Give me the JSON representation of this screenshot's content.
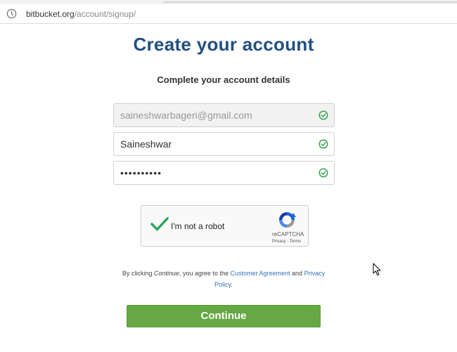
{
  "browser": {
    "url_domain": "bitbucket.org",
    "url_path": "/account/signup/"
  },
  "page": {
    "title": "Create your account",
    "subtitle": "Complete your account details"
  },
  "form": {
    "email_value": "saineshwarbageri@gmail.com",
    "name_value": "Saineshwar",
    "password_masked": "••••••••••"
  },
  "captcha": {
    "label": "I'm not a robot",
    "brand": "reCAPTCHA",
    "links": "Privacy - Terms"
  },
  "legal": {
    "prefix": "By clicking ",
    "continue_word": "Continue",
    "middle": ", you agree to the ",
    "customer_agreement": "Customer Agreement",
    "and": " and ",
    "privacy_policy": "Privacy Policy",
    "suffix": "."
  },
  "actions": {
    "continue_label": "Continue"
  },
  "icons": {
    "site_info": "info-circle-icon",
    "valid": "check-circle-icon",
    "captcha_check": "checkmark-icon",
    "captcha_logo": "recaptcha-logo-icon",
    "cursor": "mouse-pointer-icon"
  },
  "colors": {
    "title": "#205081",
    "valid_green": "#36a44f",
    "continue_bg": "#65a844",
    "link": "#3572b0"
  }
}
